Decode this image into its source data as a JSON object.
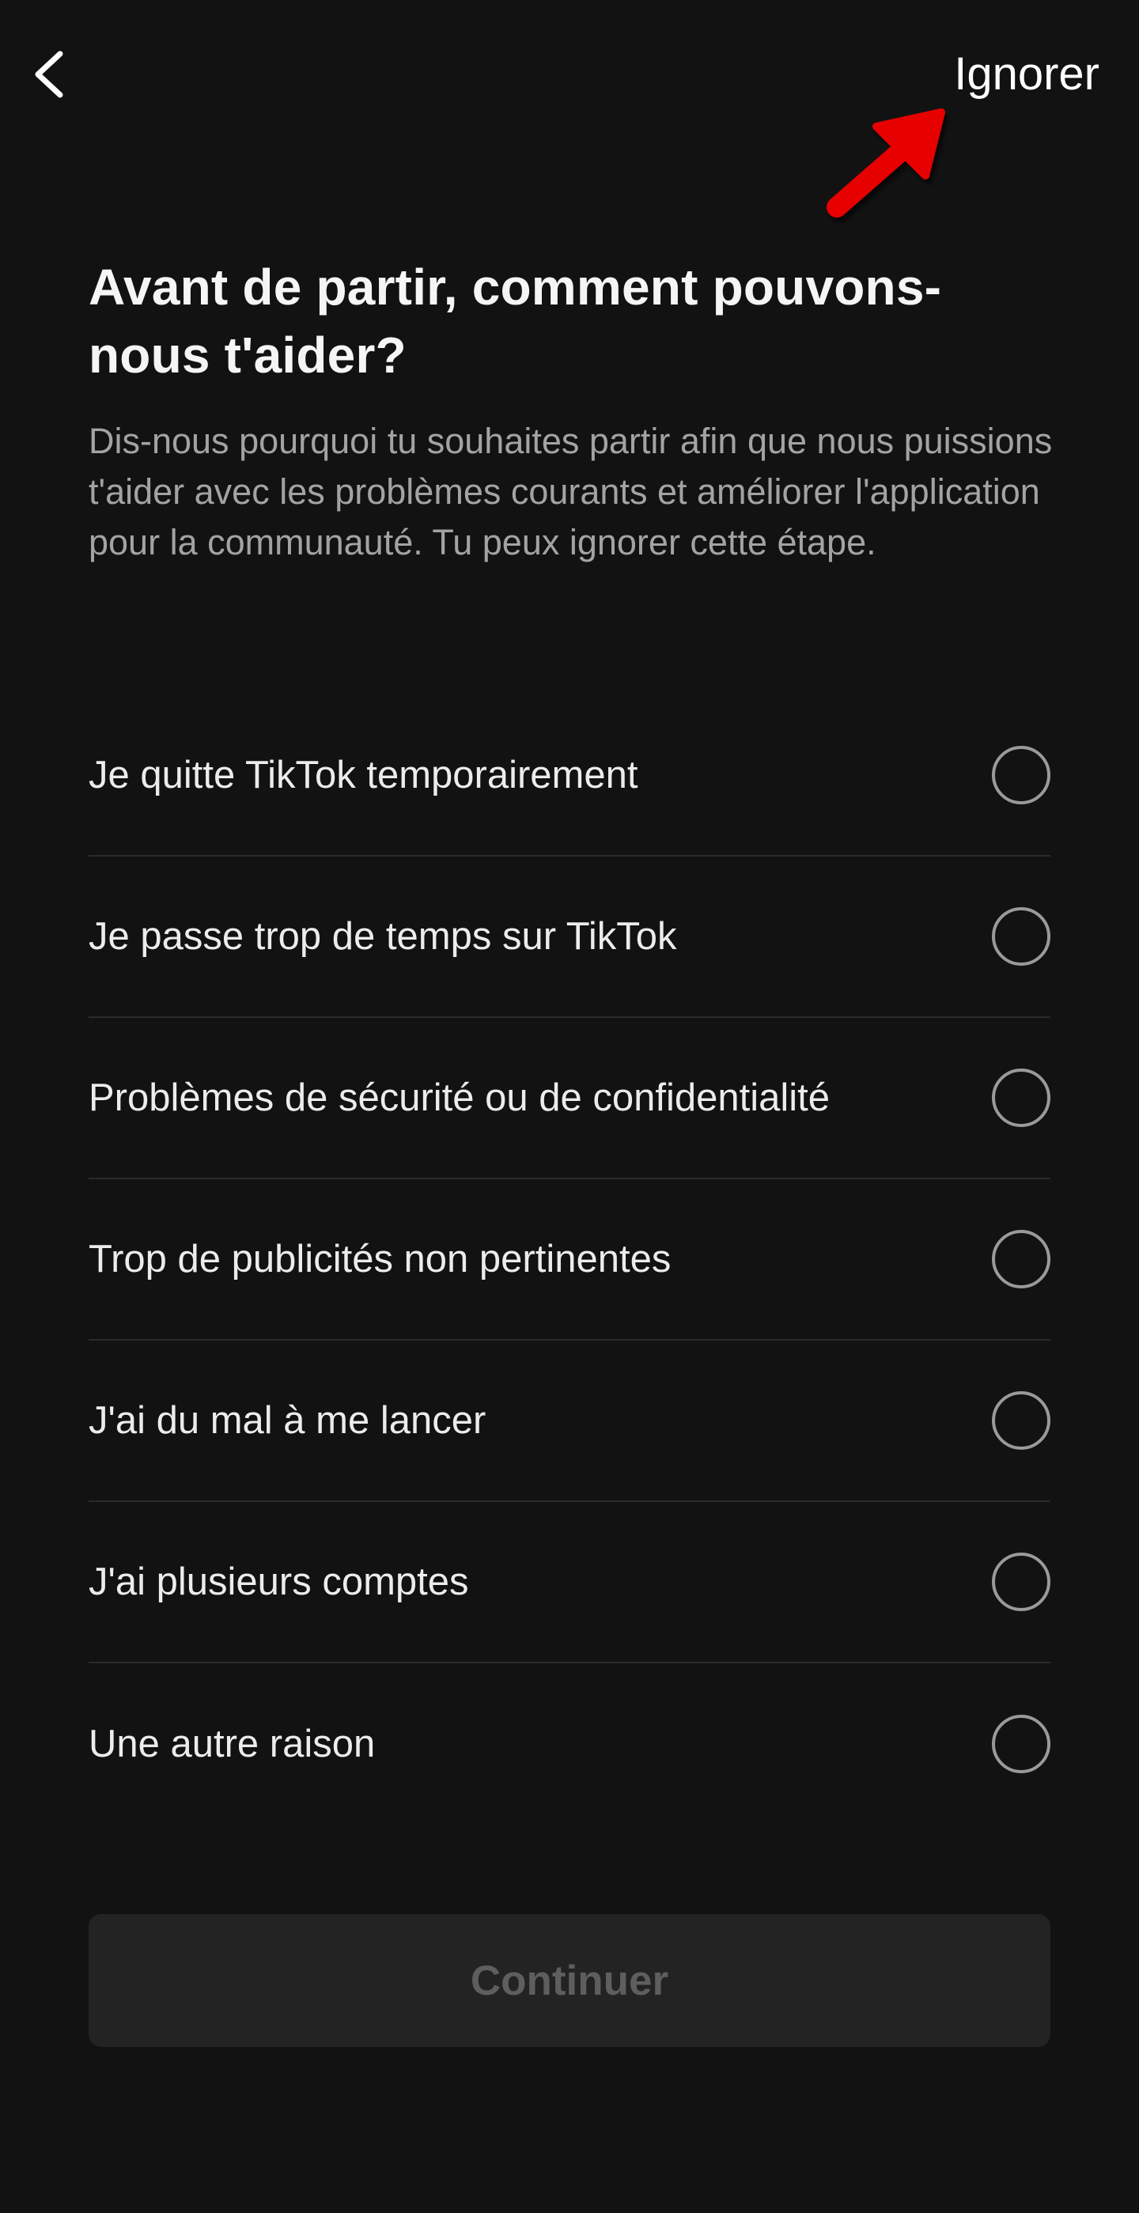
{
  "header": {
    "back_icon": "chevron-left-icon",
    "skip_label": "Ignorer"
  },
  "annotation": {
    "icon": "red-arrow-annotation-icon",
    "color": "#e60000"
  },
  "main": {
    "title": "Avant de partir, comment pouvons-nous t'aider?",
    "description": "Dis-nous pourquoi tu souhaites partir afin que nous puissions t'aider avec les problèmes courants et améliorer l'application pour la communauté. Tu peux ignorer cette étape."
  },
  "options": [
    {
      "label": "Je quitte TikTok temporairement",
      "selected": false
    },
    {
      "label": "Je passe trop de temps sur TikTok",
      "selected": false
    },
    {
      "label": "Problèmes de sécurité ou de confidentialité",
      "selected": false
    },
    {
      "label": "Trop de publicités non pertinentes",
      "selected": false
    },
    {
      "label": "J'ai du mal à me lancer",
      "selected": false
    },
    {
      "label": "J'ai plusieurs comptes",
      "selected": false
    },
    {
      "label": "Une autre raison",
      "selected": false
    }
  ],
  "footer": {
    "continue_label": "Continuer",
    "continue_enabled": false
  },
  "colors": {
    "background": "#121212",
    "text_primary": "#f2f2f2",
    "text_secondary": "#a3a3a3",
    "divider": "#2b2b2b",
    "radio_border": "#9a9a9a",
    "button_disabled_bg": "#232323",
    "button_disabled_text": "#5e5e5e"
  }
}
